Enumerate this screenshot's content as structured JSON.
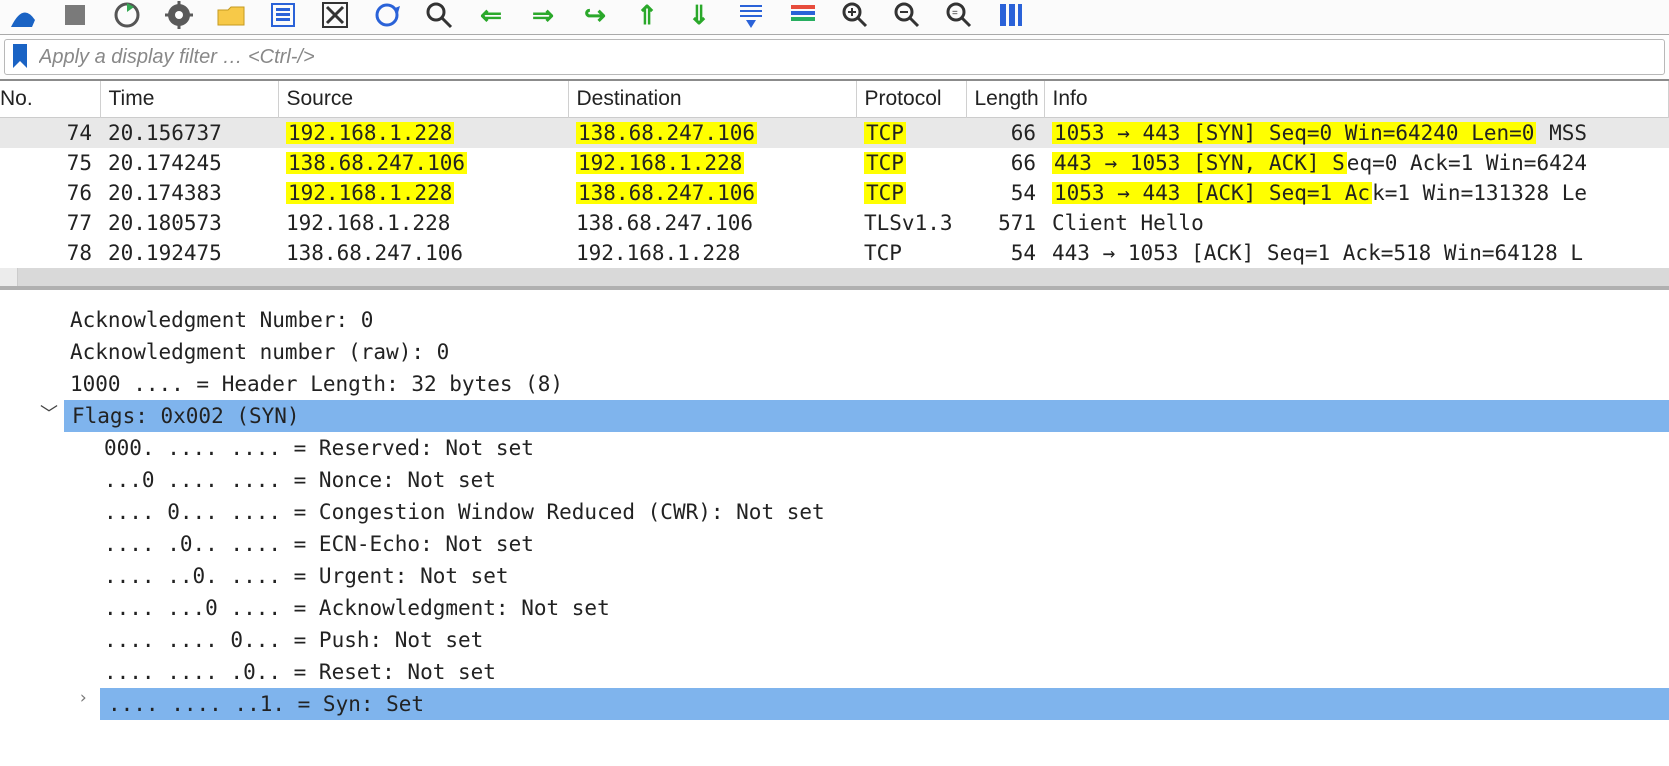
{
  "filter": {
    "placeholder": "Apply a display filter … <Ctrl-/>"
  },
  "columns": {
    "no": "No.",
    "time": "Time",
    "source": "Source",
    "destination": "Destination",
    "protocol": "Protocol",
    "length": "Length",
    "info": "Info"
  },
  "packets": [
    {
      "no": "74",
      "time": "20.156737",
      "source": "192.168.1.228",
      "destination": "138.68.247.106",
      "protocol": "TCP",
      "length": "66",
      "info": "1053 → 443 [SYN] Seq=0 Win=64240 Len=0 MSS",
      "selected": true,
      "hl_source": true,
      "hl_dest": true,
      "hl_proto": true,
      "hl_info_through_ack": true
    },
    {
      "no": "75",
      "time": "20.174245",
      "source": "138.68.247.106",
      "destination": "192.168.1.228",
      "protocol": "TCP",
      "length": "66",
      "info": "443 → 1053 [SYN, ACK] Seq=0 Ack=1 Win=6424",
      "hl_source": true,
      "hl_dest": true,
      "hl_proto": true,
      "hl_info_through_seq": true
    },
    {
      "no": "76",
      "time": "20.174383",
      "source": "192.168.1.228",
      "destination": "138.68.247.106",
      "protocol": "TCP",
      "length": "54",
      "info": "1053 → 443 [ACK] Seq=1 Ack=1 Win=131328 Le",
      "hl_source": true,
      "hl_dest": true,
      "hl_proto": true,
      "hl_info_through_ack2": true
    },
    {
      "no": "77",
      "time": "20.180573",
      "source": "192.168.1.228",
      "destination": "138.68.247.106",
      "protocol": "TLSv1.3",
      "length": "571",
      "info": "Client Hello"
    },
    {
      "no": "78",
      "time": "20.192475",
      "source": "138.68.247.106",
      "destination": "192.168.1.228",
      "protocol": "TCP",
      "length": "54",
      "info": "443 → 1053 [ACK] Seq=1 Ack=518 Win=64128 L"
    }
  ],
  "details": {
    "ack_num": "Acknowledgment Number: 0",
    "ack_raw": "Acknowledgment number (raw): 0",
    "hdr_len": "1000 .... = Header Length: 32 bytes (8)",
    "flags_header": "Flags: 0x002 (SYN)",
    "reserved": "000. .... .... = Reserved: Not set",
    "nonce": "...0 .... .... = Nonce: Not set",
    "cwr": ".... 0... .... = Congestion Window Reduced (CWR): Not set",
    "ecn": ".... .0.. .... = ECN-Echo: Not set",
    "urgent": ".... ..0. .... = Urgent: Not set",
    "ackflag": ".... ...0 .... = Acknowledgment: Not set",
    "push": ".... .... 0... = Push: Not set",
    "reset": ".... .... .0.. = Reset: Not set",
    "syn": ".... .... ..1. = Syn: Set"
  },
  "colors": {
    "highlight_yellow": "#ffff00",
    "selection_blue": "#7fb4ed"
  }
}
